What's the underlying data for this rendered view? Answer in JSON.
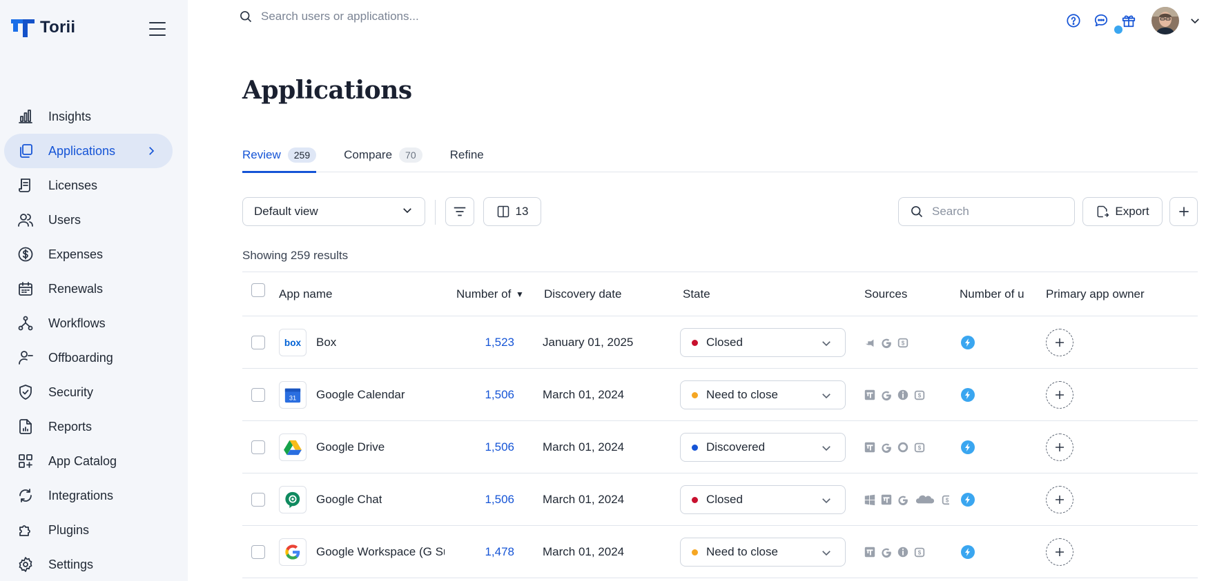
{
  "brand": {
    "name": "Torii",
    "accent": "#1554d6"
  },
  "sidebar": {
    "items": [
      {
        "label": "Insights",
        "icon": "chart-bar-icon"
      },
      {
        "label": "Applications",
        "icon": "copy-icon",
        "active": true
      },
      {
        "label": "Licenses",
        "icon": "receipt-icon"
      },
      {
        "label": "Users",
        "icon": "users-icon"
      },
      {
        "label": "Expenses",
        "icon": "dollar-circle-icon"
      },
      {
        "label": "Renewals",
        "icon": "calendar-icon"
      },
      {
        "label": "Workflows",
        "icon": "workflow-icon"
      },
      {
        "label": "Offboarding",
        "icon": "user-minus-icon"
      },
      {
        "label": "Security",
        "icon": "shield-icon"
      },
      {
        "label": "Reports",
        "icon": "report-icon"
      },
      {
        "label": "App Catalog",
        "icon": "grid-plus-icon"
      },
      {
        "label": "Integrations",
        "icon": "sync-icon"
      },
      {
        "label": "Plugins",
        "icon": "puzzle-icon"
      },
      {
        "label": "Settings",
        "icon": "gear-icon"
      }
    ]
  },
  "topbar": {
    "search_placeholder": "Search users or applications..."
  },
  "page": {
    "title": "Applications",
    "tabs": [
      {
        "label": "Review",
        "count": "259",
        "active": true
      },
      {
        "label": "Compare",
        "count": "70"
      },
      {
        "label": "Refine",
        "count": ""
      }
    ],
    "toolbar": {
      "view_label": "Default view",
      "columns_count": "13",
      "search_placeholder": "Search",
      "export_label": "Export"
    },
    "results_text": "Showing 259 results"
  },
  "table": {
    "headers": {
      "app_name": "App name",
      "number_of": "Number of",
      "discovery": "Discovery date",
      "state": "State",
      "sources": "Sources",
      "number_of_u": "Number of u",
      "owner": "Primary app owner"
    },
    "rows": [
      {
        "name": "Box",
        "number": "1,523",
        "date": "January 01, 2025",
        "state": "Closed",
        "state_color": "#c8102e",
        "logo": "box-logo",
        "sources": [
          "plug-icon",
          "google-g-icon",
          "expense-icon"
        ]
      },
      {
        "name": "Google Calendar",
        "number": "1,506",
        "date": "March 01, 2024",
        "state": "Need to close",
        "state_color": "#f5a623",
        "logo": "google-calendar-logo",
        "sources": [
          "torii-icon",
          "google-g-icon",
          "info-circle-icon",
          "expense-icon"
        ]
      },
      {
        "name": "Google Drive",
        "number": "1,506",
        "date": "March 01, 2024",
        "state": "Discovered",
        "state_color": "#1554d6",
        "logo": "google-drive-logo",
        "sources": [
          "torii-icon",
          "google-g-icon",
          "ring-icon",
          "expense-icon"
        ]
      },
      {
        "name": "Google Chat",
        "number": "1,506",
        "date": "March 01, 2024",
        "state": "Closed",
        "state_color": "#c8102e",
        "logo": "google-chat-logo",
        "sources": [
          "windows-icon",
          "torii-icon",
          "google-g-icon",
          "cloud-icon",
          "expense-icon"
        ]
      },
      {
        "name": "Google Workspace (G Suite)",
        "number": "1,478",
        "date": "March 01, 2024",
        "state": "Need to close",
        "state_color": "#f5a623",
        "logo": "google-logo",
        "sources": [
          "torii-icon",
          "google-g-icon",
          "info-circle-icon",
          "expense-icon"
        ]
      }
    ]
  }
}
